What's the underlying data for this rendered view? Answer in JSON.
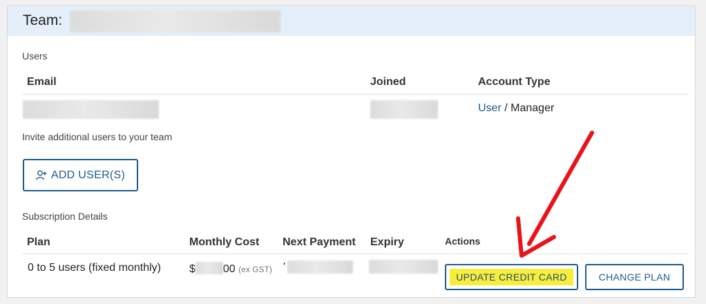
{
  "team": {
    "label": "Team:"
  },
  "users_section": {
    "title": "Users",
    "columns": [
      "Email",
      "Joined",
      "Account Type"
    ],
    "rows": [
      {
        "account_type_link": "User",
        "account_type_sep": "/",
        "account_type_current": "Manager"
      }
    ],
    "invite_text": "Invite additional users to your team",
    "add_users_button": "ADD USER(S)"
  },
  "subscription": {
    "title": "Subscription Details",
    "columns": [
      "Plan",
      "Monthly Cost",
      "Next Payment",
      "Expiry",
      "Actions"
    ],
    "row": {
      "plan": "0 to 5 users (fixed monthly)",
      "cost_prefix": "$",
      "cost_suffix": "00",
      "cost_note": "(ex GST)",
      "next_payment_prefix": "'"
    },
    "actions": {
      "update_card": "UPDATE CREDIT CARD",
      "change_plan": "CHANGE PLAN"
    }
  },
  "colors": {
    "accent": "#1e5a8e",
    "header_bg": "#e4eff9",
    "highlight": "#f7ee3c",
    "annotation_arrow": "#e8141a"
  },
  "icons": {
    "add_user": "user-plus-icon",
    "annotation": "red-arrow-icon"
  }
}
